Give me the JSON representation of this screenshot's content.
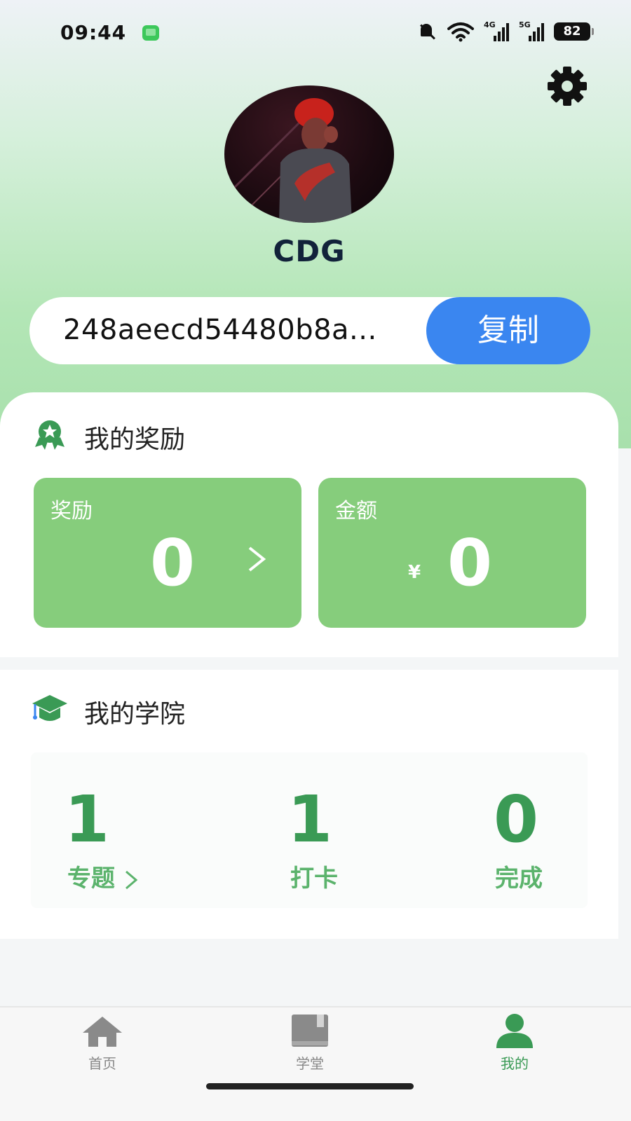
{
  "status": {
    "time": "09:44",
    "sig1_tag": "4G",
    "sig2_tag": "5G",
    "battery": "82"
  },
  "profile": {
    "name": "CDG",
    "id_text": "248aeecd54480b8a...",
    "copy_label": "复制"
  },
  "rewards": {
    "title": "我的奖励",
    "reward_label": "奖励",
    "reward_value": "0",
    "amount_label": "金额",
    "currency": "¥",
    "amount_value": "0",
    "box_color": "#86cd7c"
  },
  "academy": {
    "title": "我的学院",
    "stats": [
      {
        "value": "1",
        "label": "专题"
      },
      {
        "value": "1",
        "label": "打卡"
      },
      {
        "value": "0",
        "label": "完成"
      }
    ]
  },
  "tabs": [
    {
      "label": "首页",
      "icon": "home-icon"
    },
    {
      "label": "学堂",
      "icon": "book-icon"
    },
    {
      "label": "我的",
      "icon": "user-icon",
      "active": true
    }
  ],
  "colors": {
    "accent": "#3a86f0",
    "green": "#3a9a55"
  }
}
